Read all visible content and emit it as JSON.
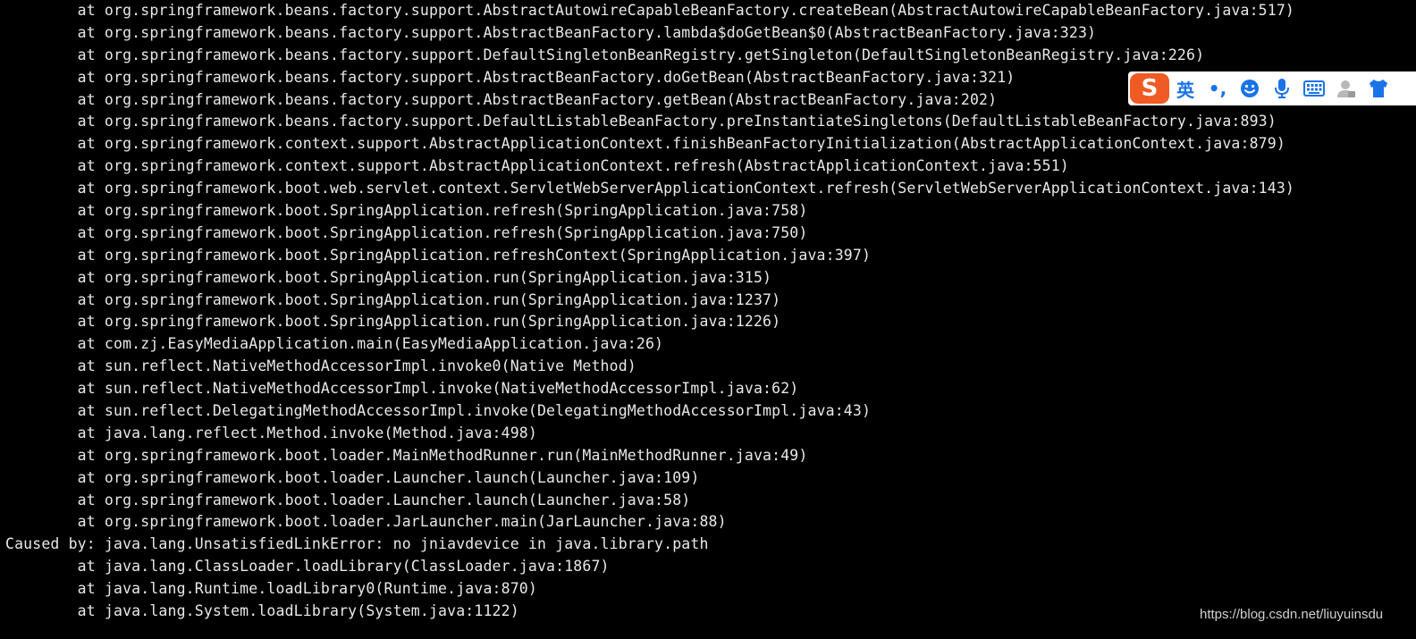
{
  "terminal": {
    "lines": [
      "        at org.springframework.beans.factory.support.AbstractAutowireCapableBeanFactory.createBean(AbstractAutowireCapableBeanFactory.java:517)",
      "        at org.springframework.beans.factory.support.AbstractBeanFactory.lambda$doGetBean$0(AbstractBeanFactory.java:323)",
      "        at org.springframework.beans.factory.support.DefaultSingletonBeanRegistry.getSingleton(DefaultSingletonBeanRegistry.java:226)",
      "        at org.springframework.beans.factory.support.AbstractBeanFactory.doGetBean(AbstractBeanFactory.java:321)",
      "        at org.springframework.beans.factory.support.AbstractBeanFactory.getBean(AbstractBeanFactory.java:202)",
      "        at org.springframework.beans.factory.support.DefaultListableBeanFactory.preInstantiateSingletons(DefaultListableBeanFactory.java:893)",
      "        at org.springframework.context.support.AbstractApplicationContext.finishBeanFactoryInitialization(AbstractApplicationContext.java:879)",
      "        at org.springframework.context.support.AbstractApplicationContext.refresh(AbstractApplicationContext.java:551)",
      "        at org.springframework.boot.web.servlet.context.ServletWebServerApplicationContext.refresh(ServletWebServerApplicationContext.java:143)",
      "        at org.springframework.boot.SpringApplication.refresh(SpringApplication.java:758)",
      "        at org.springframework.boot.SpringApplication.refresh(SpringApplication.java:750)",
      "        at org.springframework.boot.SpringApplication.refreshContext(SpringApplication.java:397)",
      "        at org.springframework.boot.SpringApplication.run(SpringApplication.java:315)",
      "        at org.springframework.boot.SpringApplication.run(SpringApplication.java:1237)",
      "        at org.springframework.boot.SpringApplication.run(SpringApplication.java:1226)",
      "        at com.zj.EasyMediaApplication.main(EasyMediaApplication.java:26)",
      "        at sun.reflect.NativeMethodAccessorImpl.invoke0(Native Method)",
      "        at sun.reflect.NativeMethodAccessorImpl.invoke(NativeMethodAccessorImpl.java:62)",
      "        at sun.reflect.DelegatingMethodAccessorImpl.invoke(DelegatingMethodAccessorImpl.java:43)",
      "        at java.lang.reflect.Method.invoke(Method.java:498)",
      "        at org.springframework.boot.loader.MainMethodRunner.run(MainMethodRunner.java:49)",
      "        at org.springframework.boot.loader.Launcher.launch(Launcher.java:109)",
      "        at org.springframework.boot.loader.Launcher.launch(Launcher.java:58)",
      "        at org.springframework.boot.loader.JarLauncher.main(JarLauncher.java:88)",
      "Caused by: java.lang.UnsatisfiedLinkError: no jniavdevice in java.library.path",
      "        at java.lang.ClassLoader.loadLibrary(ClassLoader.java:1867)",
      "        at java.lang.Runtime.loadLibrary0(Runtime.java:870)",
      "        at java.lang.System.loadLibrary(System.java:1122)"
    ]
  },
  "ime_toolbar": {
    "logo_glyph": "S",
    "lang_label": "英",
    "punct_label": "•,",
    "icons": [
      "emoji-icon",
      "microphone-icon",
      "keyboard-icon",
      "user-icon",
      "skin-icon"
    ],
    "accent_color": "#1a73e8",
    "logo_color": "#f05a24"
  },
  "watermark": {
    "text": "https://blog.csdn.net/liuyuinsdu"
  }
}
